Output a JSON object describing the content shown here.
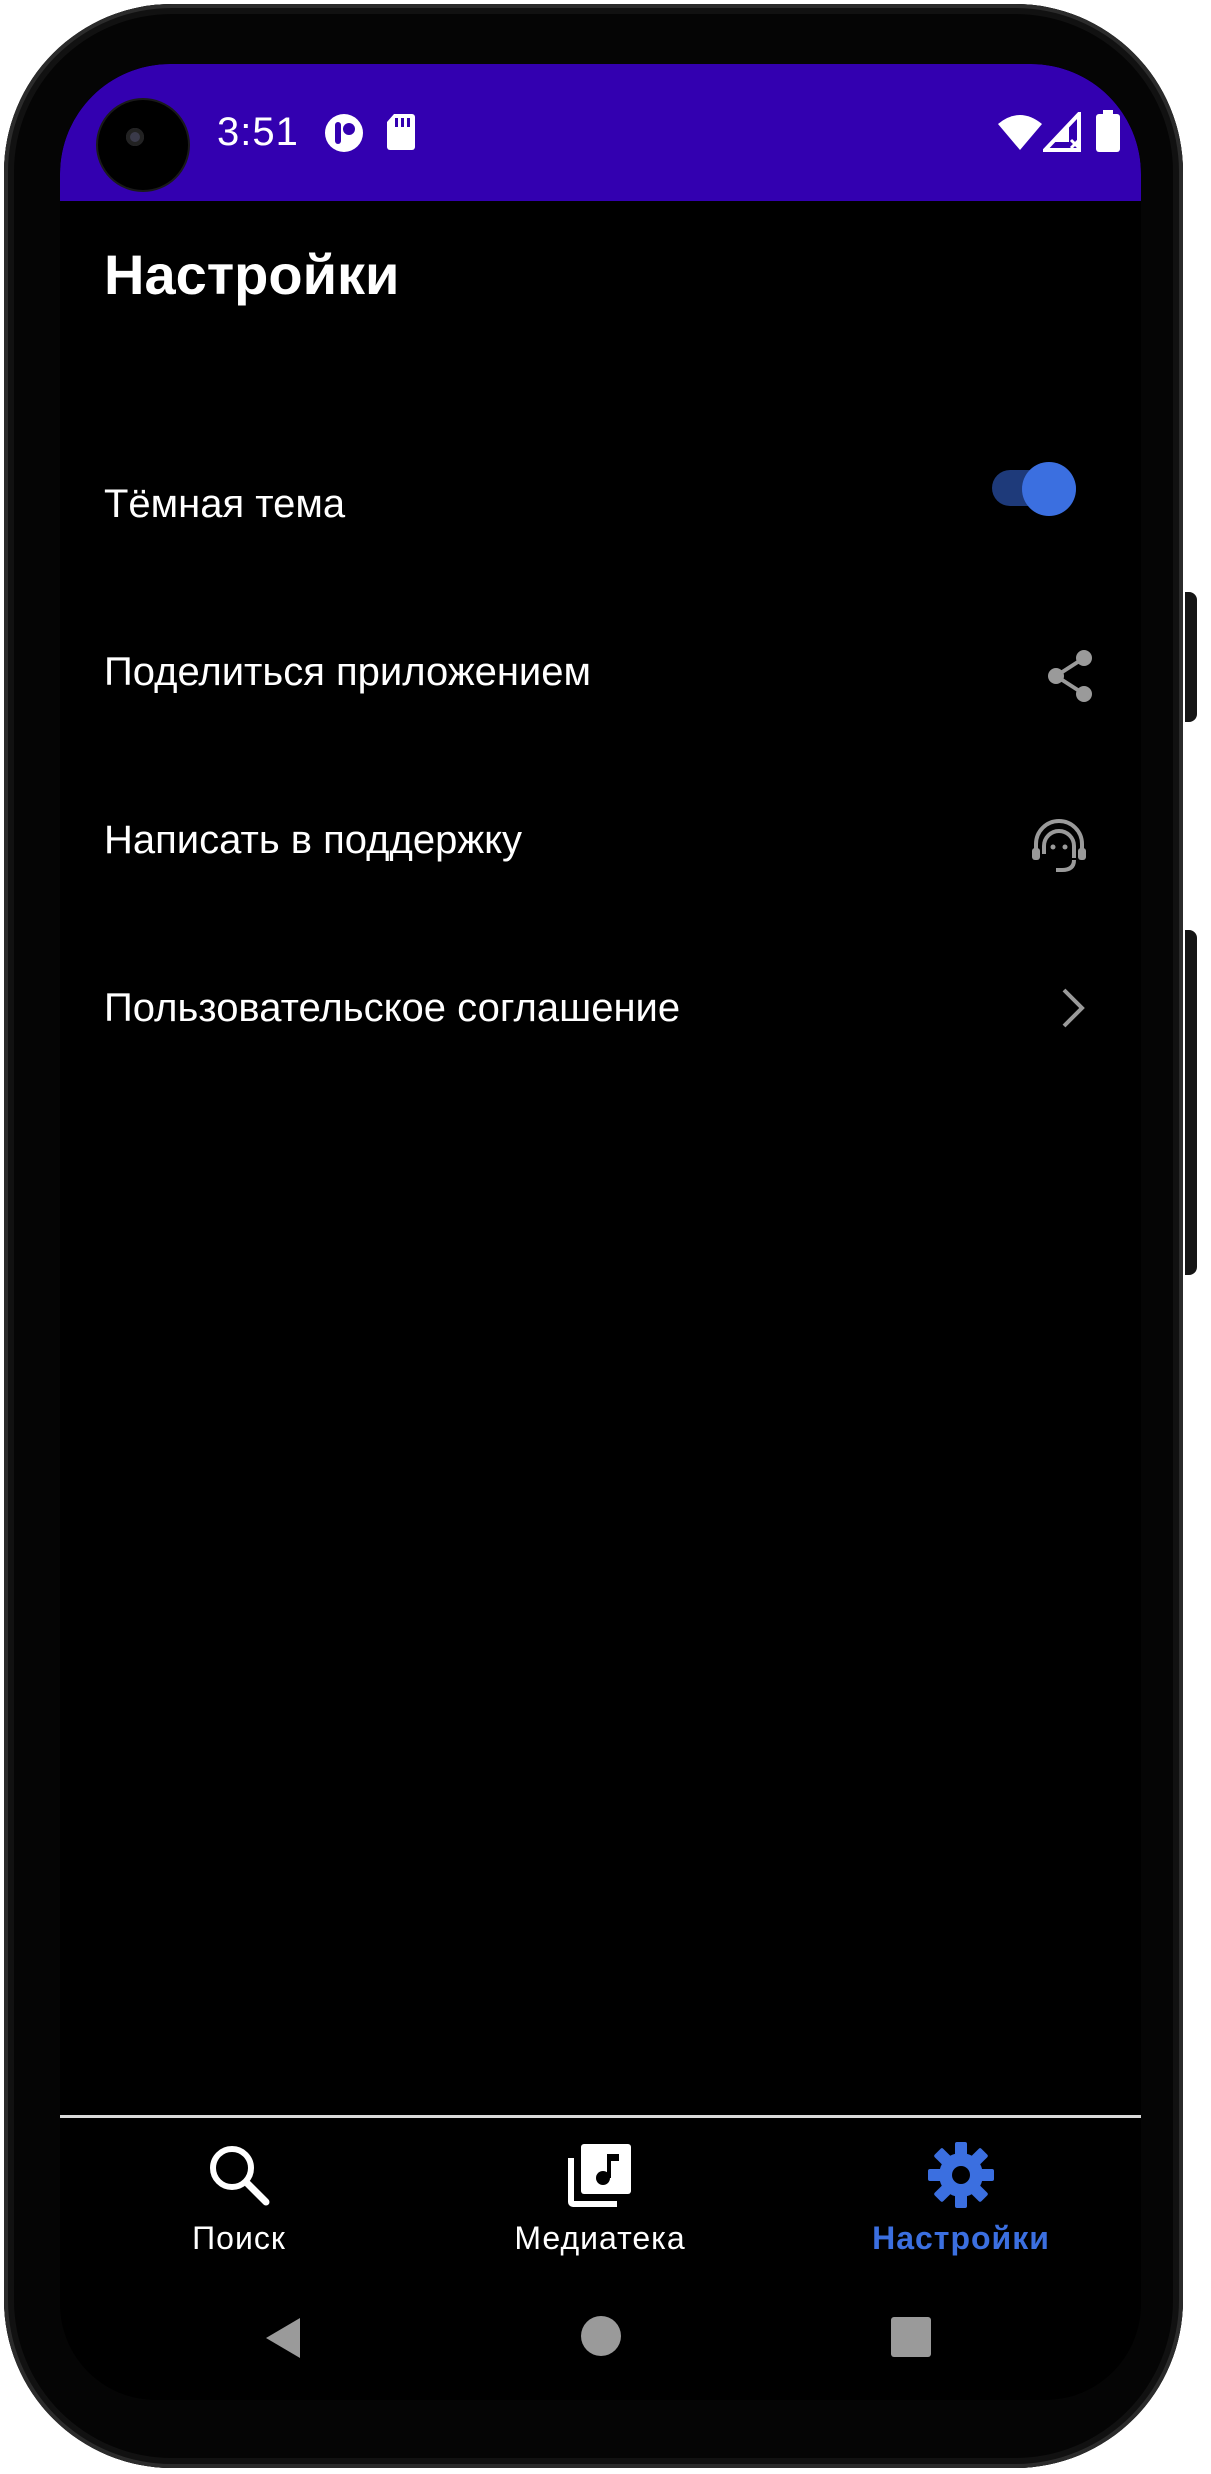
{
  "status_bar": {
    "time": "3:51",
    "background": "#3300b0",
    "icons": [
      "camera-punch-hole",
      "app-notification-icon",
      "sd-card-icon",
      "wifi-icon",
      "signal-icon",
      "battery-icon"
    ]
  },
  "page": {
    "title": "Настройки"
  },
  "settings": [
    {
      "label": "Тёмная тема",
      "control": "toggle",
      "toggle_on": true
    },
    {
      "label": "Поделиться приложением",
      "icon": "share-icon"
    },
    {
      "label": "Написать в поддержку",
      "icon": "support-headset-icon"
    },
    {
      "label": "Пользовательское соглашение",
      "icon": "chevron-right-icon"
    }
  ],
  "bottom_nav": {
    "items": [
      {
        "label": "Поиск",
        "icon": "search-icon",
        "active": false
      },
      {
        "label": "Медиатека",
        "icon": "media-library-icon",
        "active": false
      },
      {
        "label": "Настройки",
        "icon": "gear-icon",
        "active": true
      }
    ],
    "active_color": "#3b6fe0"
  },
  "system_nav": {
    "buttons": [
      "back-icon",
      "home-icon",
      "recents-icon"
    ]
  },
  "colors": {
    "background": "#000000",
    "text": "#ffffff",
    "accent": "#3b6fe0",
    "icon_gray": "#9a9a9a"
  }
}
